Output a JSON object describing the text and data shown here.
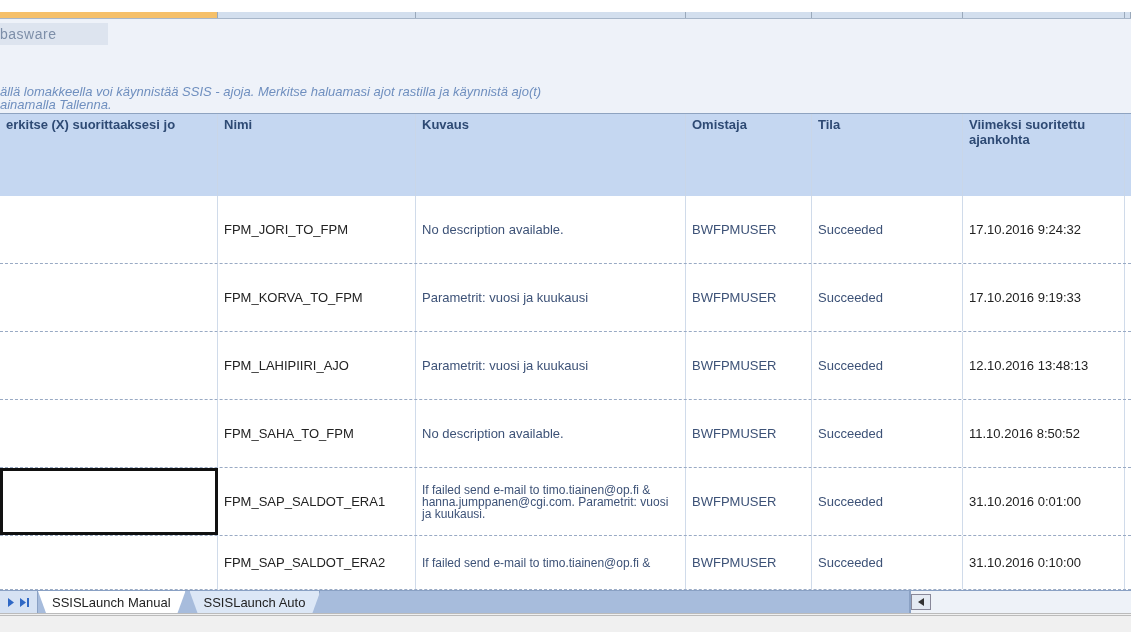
{
  "logo": {
    "text": "basware"
  },
  "intro": [
    "ällä lomakkeella voi käynnistää SSIS - ajoja. Merkitse haluamasi ajot rastilla ja käynnistä ajo(t)",
    "ainamalla Tallenna."
  ],
  "table": {
    "columns": [
      "erkitse (X) suorittaaksesi jo",
      "Nimi",
      "Kuvaus",
      "Omistaja",
      "Tila",
      "Viimeksi suoritettu ajankohta"
    ],
    "rows": [
      {
        "selected": false,
        "name": "FPM_JORI_TO_FPM",
        "description": "No description available.",
        "owner": "BWFPMUSER",
        "status": "Succeeded",
        "last_run": "17.10.2016 9:24:32"
      },
      {
        "selected": false,
        "name": "FPM_KORVA_TO_FPM",
        "description": "Parametrit: vuosi ja kuukausi",
        "owner": "BWFPMUSER",
        "status": "Succeeded",
        "last_run": "17.10.2016 9:19:33"
      },
      {
        "selected": false,
        "name": "FPM_LAHIPIIRI_AJO",
        "description": "Parametrit: vuosi ja kuukausi",
        "owner": "BWFPMUSER",
        "status": "Succeeded",
        "last_run": "12.10.2016 13:48:13"
      },
      {
        "selected": false,
        "name": "FPM_SAHA_TO_FPM",
        "description": "No description available.",
        "owner": "BWFPMUSER",
        "status": "Succeeded",
        "last_run": "11.10.2016 8:50:52"
      },
      {
        "selected": true,
        "name": "FPM_SAP_SALDOT_ERA1",
        "description": "If failed send e-mail to timo.tiainen@op.fi & hanna.jumppanen@cgi.com. Parametrit: vuosi ja kuukausi.",
        "owner": "BWFPMUSER",
        "status": "Succeeded",
        "last_run": "31.10.2016 0:01:00"
      },
      {
        "selected": false,
        "name": "FPM_SAP_SALDOT_ERA2",
        "description": "If failed send e-mail to timo.tiainen@op.fi &",
        "owner": "BWFPMUSER",
        "status": "Succeeded",
        "last_run": "31.10.2016 0:10:00"
      }
    ]
  },
  "sheet_tabs": [
    {
      "label": "SSISLaunch Manual",
      "selected": true
    },
    {
      "label": "SSISLaunch Auto",
      "selected": false
    }
  ]
}
